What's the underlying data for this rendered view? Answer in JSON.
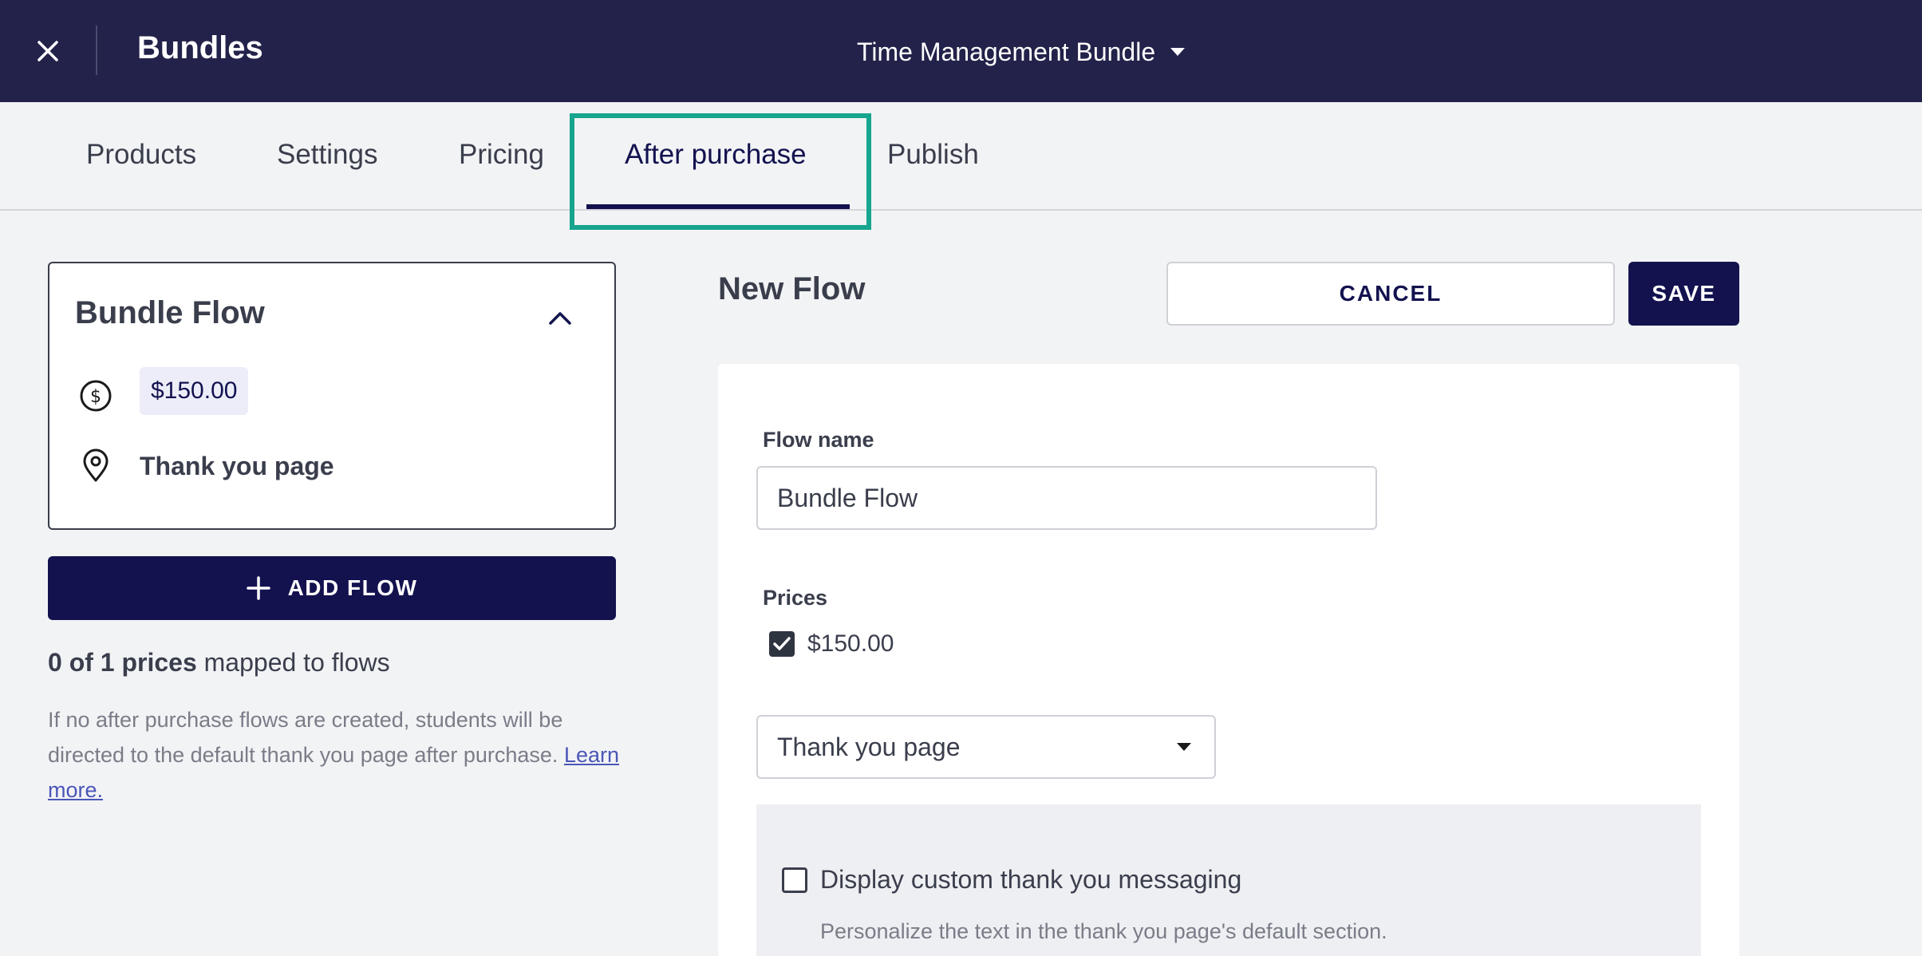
{
  "header": {
    "title": "Bundles",
    "bundle_name": "Time Management Bundle"
  },
  "tabs": [
    {
      "label": "Products",
      "active": false
    },
    {
      "label": "Settings",
      "active": false
    },
    {
      "label": "Pricing",
      "active": false
    },
    {
      "label": "After purchase",
      "active": true
    },
    {
      "label": "Publish",
      "active": false
    }
  ],
  "sidebar": {
    "flow_card": {
      "title": "Bundle Flow",
      "price": "$150.00",
      "destination": "Thank you page"
    },
    "add_flow_label": "ADD FLOW",
    "mapped_count": "0 of 1 prices",
    "mapped_suffix": " mapped to flows",
    "help_text": "If no after purchase flows are created, students will be directed to the default thank you page after purchase. ",
    "help_link": "Learn more."
  },
  "form": {
    "title": "New Flow",
    "cancel_label": "CANCEL",
    "save_label": "SAVE",
    "flow_name_label": "Flow name",
    "flow_name_value": "Bundle Flow",
    "prices_label": "Prices",
    "price_option": "$150.00",
    "price_checked": true,
    "destination_value": "Thank you page",
    "custom_message_label": "Display custom thank you messaging",
    "custom_message_checked": false,
    "custom_message_desc": "Personalize the text in the thank you page's default section."
  },
  "colors": {
    "header_bg": "#22224a",
    "primary": "#13124f",
    "highlight": "#16a58e",
    "page_bg": "#f2f3f5"
  },
  "icons": [
    "close-icon",
    "caret-down-icon",
    "chevron-up-icon",
    "dollar-circle-icon",
    "location-pin-icon",
    "plus-icon",
    "checkmark-icon"
  ]
}
